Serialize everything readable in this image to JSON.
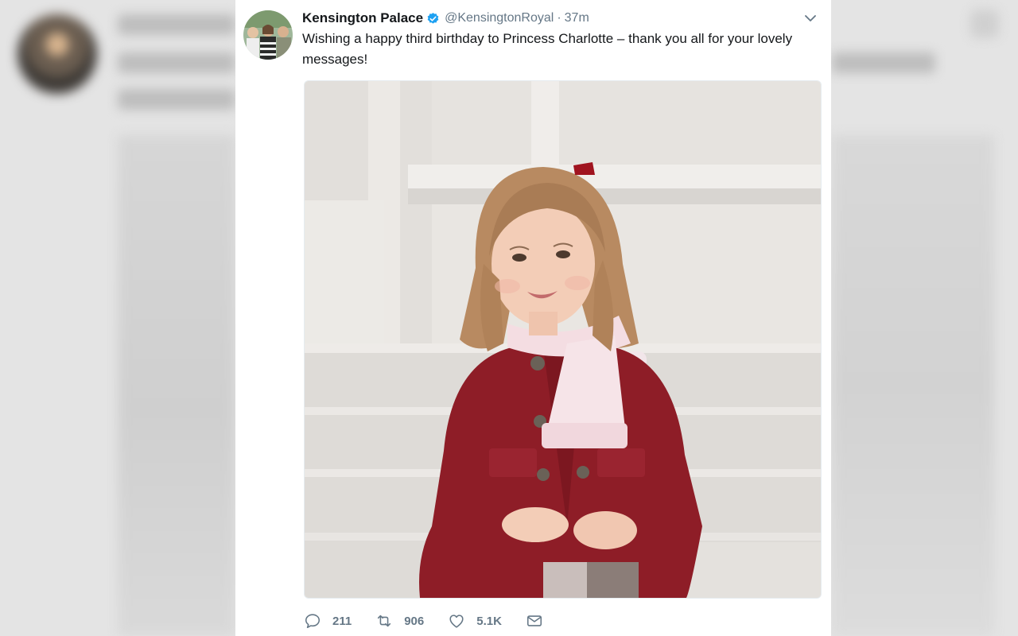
{
  "tweet": {
    "display_name": "Kensington Palace",
    "handle": "@KensingtonRoyal",
    "separator": "·",
    "time": "37m",
    "text": "Wishing a happy third birthday to Princess Charlotte – thank you all for your lovely messages!",
    "verified_icon": "verified-badge-icon",
    "menu_icon": "chevron-down-icon"
  },
  "actions": {
    "reply_count": "211",
    "retweet_count": "906",
    "like_count": "5.1K"
  },
  "colors": {
    "accent": "#1da1f2",
    "muted_text": "#657786",
    "primary_text": "#14171a"
  }
}
